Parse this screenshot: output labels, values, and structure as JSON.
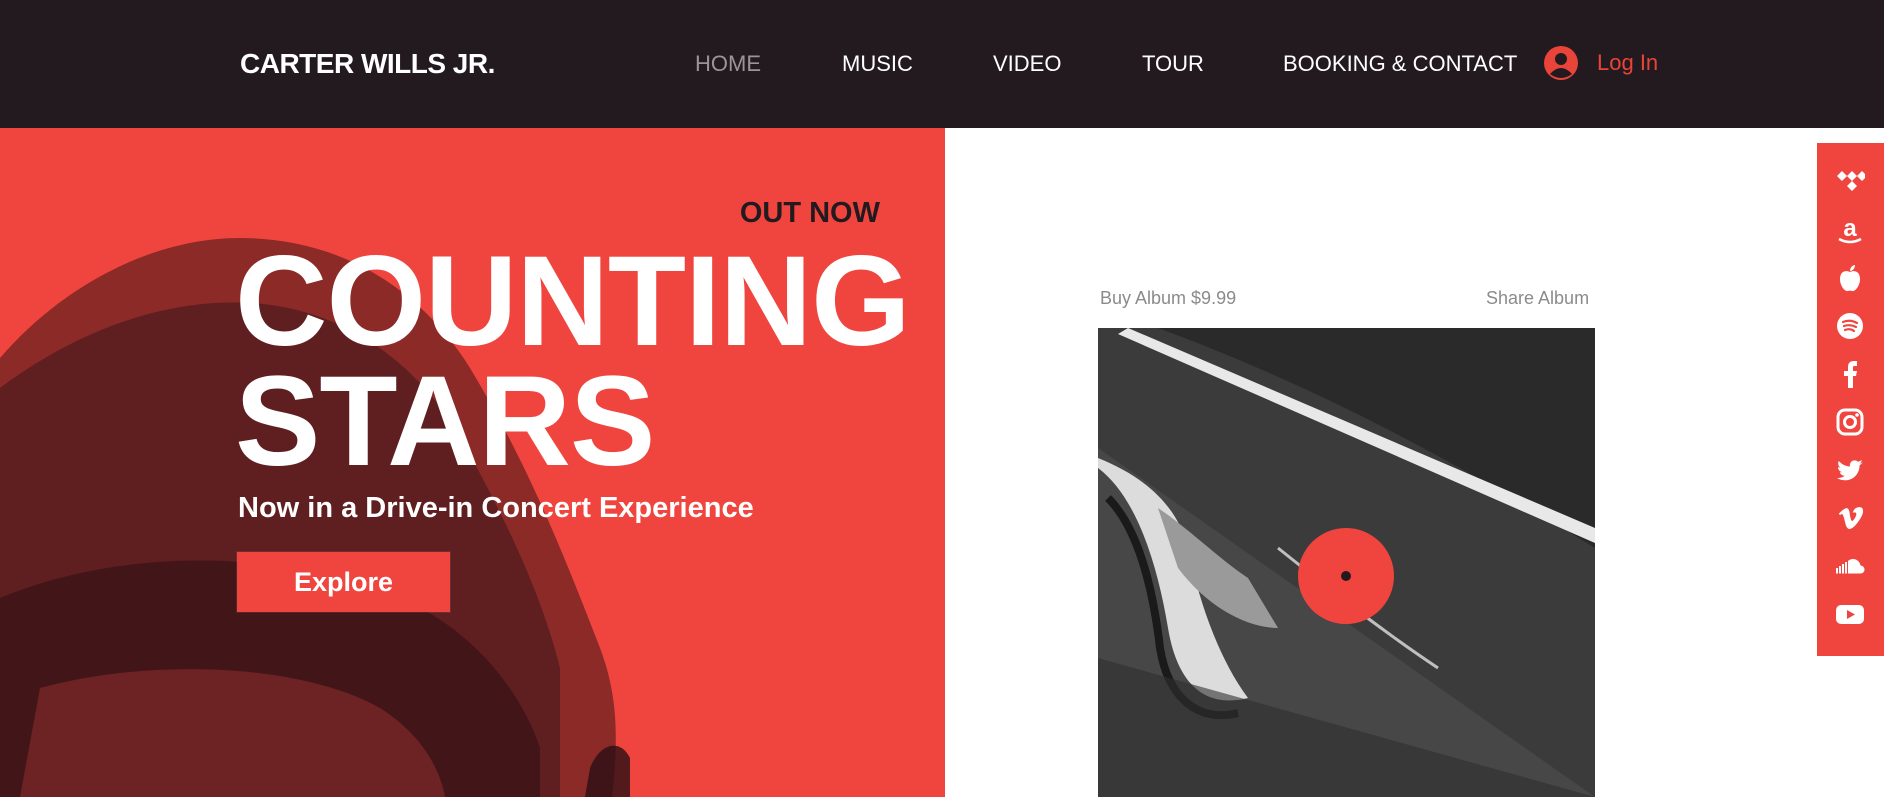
{
  "header": {
    "brand": "CARTER WILLS JR.",
    "nav": [
      "HOME",
      "MUSIC",
      "VIDEO",
      "TOUR",
      "BOOKING & CONTACT"
    ],
    "active_nav": "HOME",
    "login_label": "Log In"
  },
  "hero": {
    "tag": "OUT NOW",
    "title_line1": "COUNTING",
    "title_line2": "STARS",
    "subtitle": "Now in a Drive-in Concert Experience",
    "cta_label": "Explore"
  },
  "album": {
    "buy_label": "Buy Album $9.99",
    "share_label": "Share Album"
  },
  "social": {
    "icons": [
      "tidal-icon",
      "amazon-icon",
      "apple-icon",
      "spotify-icon",
      "facebook-icon",
      "instagram-icon",
      "twitter-icon",
      "vimeo-icon",
      "soundcloud-icon",
      "youtube-icon"
    ]
  },
  "colors": {
    "header_bg": "#231a1f",
    "accent": "#f0453f",
    "login": "#e84439",
    "nav_active": "#9a9498"
  }
}
